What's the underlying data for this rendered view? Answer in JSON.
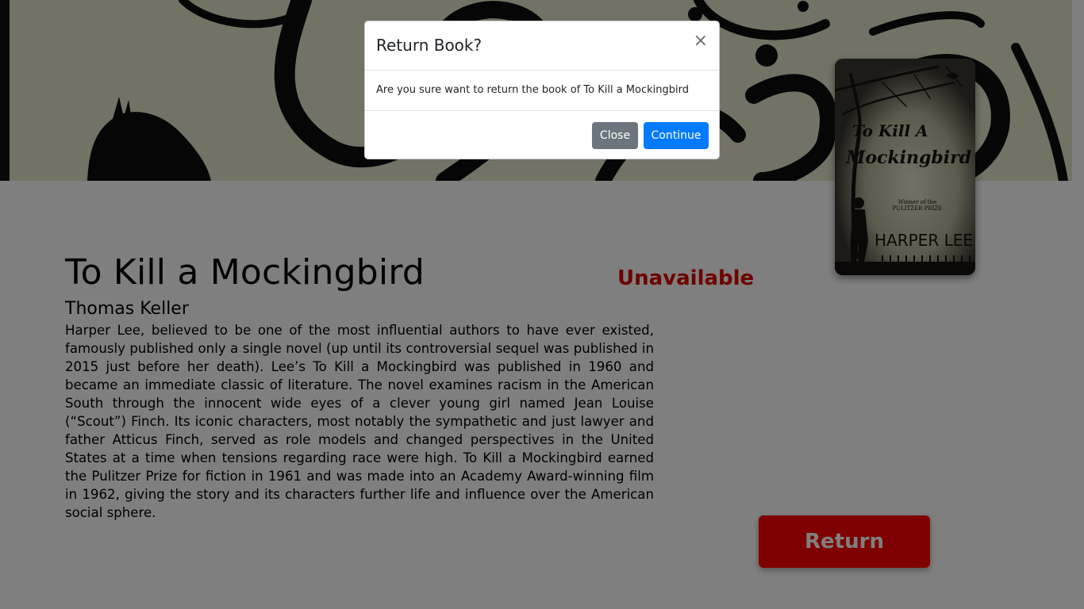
{
  "book": {
    "title": "To Kill a Mockingbird",
    "status": "Unavailable",
    "author": "Thomas Keller",
    "description": "Harper Lee, believed to be one of the most influential authors to have ever existed, famously published only a single novel (up until its controversial sequel was published in 2015 just before her death). Lee’s To Kill a Mockingbird was published in 1960 and became an immediate classic of literature. The novel examines racism in the American South through the innocent wide eyes of a clever young girl named Jean Louise (“Scout”) Finch. Its iconic characters, most notably the sympathetic and just lawyer and father Atticus Finch, served as role models and changed perspectives in the United States at a time when tensions regarding race were high. To Kill a Mockingbird earned the Pulitzer Prize for fiction in 1961 and was made into an Academy Award-winning film in 1962, giving the story and its characters further life and influence over the American social sphere.",
    "return_label": "Return"
  },
  "cover": {
    "title_line1": "To Kill A",
    "title_line2": "Mockingbird",
    "award_line1": "Winner of the",
    "award_line2": "PULITZER PRIZE",
    "author_name": "HARPER LEE"
  },
  "modal": {
    "title": "Return Book?",
    "close_symbol": "×",
    "message": "Are you sure want to return the book of To Kill a Mockingbird",
    "close_label": "Close",
    "continue_label": "Continue"
  },
  "colors": {
    "status_red": "#dc0000",
    "return_button": "#ff0000",
    "continue_button": "#007bff",
    "close_button": "#6c757d",
    "backdrop": "rgba(0,0,0,0.5)"
  }
}
